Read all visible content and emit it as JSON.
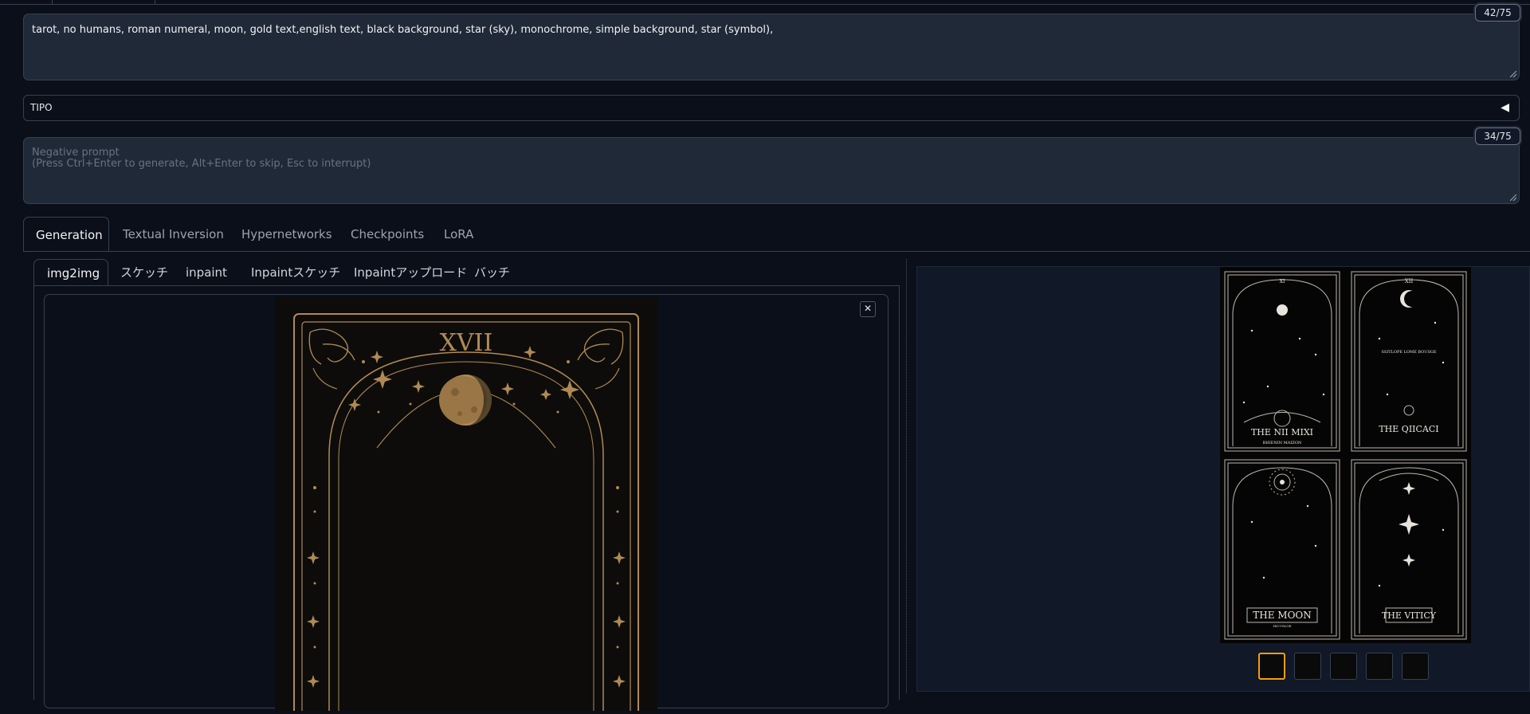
{
  "prompt": {
    "text": "tarot, no humans, roman numeral, moon, gold text,english text, black background, star (sky), monochrome, simple background, star (symbol),",
    "token_count": "42/75"
  },
  "tipo": {
    "title": "TIPO",
    "toggle_glyph": "◀"
  },
  "negative_prompt": {
    "placeholder": "Negative prompt\n(Press Ctrl+Enter to generate, Alt+Enter to skip, Esc to interrupt)",
    "token_count": "34/75"
  },
  "tabs": [
    {
      "label": "Generation",
      "selected": true
    },
    {
      "label": "Textual Inversion"
    },
    {
      "label": "Hypernetworks"
    },
    {
      "label": "Checkpoints"
    },
    {
      "label": "LoRA"
    }
  ],
  "subtabs": [
    {
      "label": "img2img",
      "selected": true
    },
    {
      "label": "スケッチ"
    },
    {
      "label": "inpaint"
    },
    {
      "label": "Inpaintスケッチ"
    },
    {
      "label": "Inpaintアップロード"
    },
    {
      "label": "バッチ"
    }
  ],
  "image_editor": {
    "clear_glyph": "✕",
    "card": {
      "numeral": "XVII",
      "accent_color": "#b08a55"
    }
  },
  "gallery": {
    "cards": [
      {
        "numeral": "XI",
        "title": "THE NII MIXI",
        "subtitle": "BHIENIN MAIZON"
      },
      {
        "numeral": "XII",
        "title": "THE QIICACI",
        "subtitle": "SSITLOPE LOME BOUSGE"
      },
      {
        "numeral": "",
        "title": "THE MOON",
        "subtitle": "HICUSLOE"
      },
      {
        "numeral": "",
        "title": "THE VITICY",
        "subtitle": ""
      }
    ],
    "thumbnail_count": 5,
    "selected_thumbnail": 0,
    "selected_color": "#f59e0b"
  },
  "theme": {
    "background": "#0b0f19",
    "panel": "#1f2937",
    "border": "#374151"
  }
}
